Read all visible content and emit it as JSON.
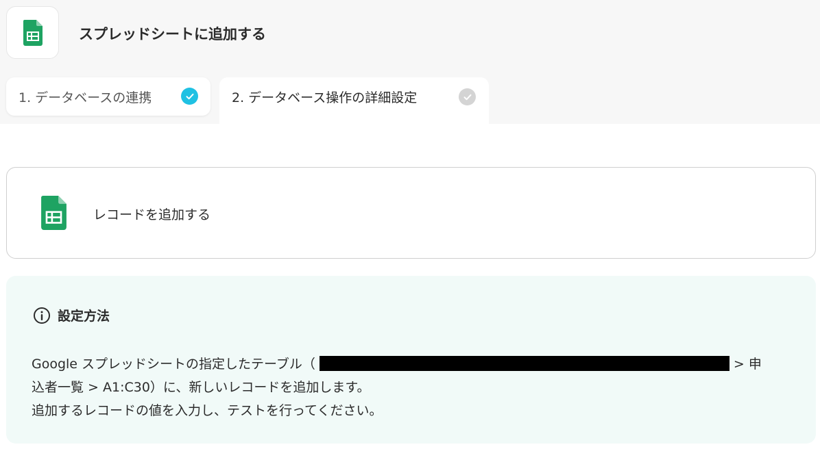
{
  "header": {
    "title": "スプレッドシートに追加する",
    "app_icon": "google-sheets-icon"
  },
  "tabs": [
    {
      "label": "1. データベースの連携",
      "status": "complete",
      "status_color": "#1fc1e3"
    },
    {
      "label": "2. データベース操作の詳細設定",
      "status": "pending",
      "status_color": "#d4d4d4"
    }
  ],
  "action": {
    "label": "レコードを追加する",
    "icon": "google-sheets-icon"
  },
  "info": {
    "title": "設定方法",
    "line1_pre": "Google スプレッドシートの指定したテーブル（",
    "line1_post": "> 申",
    "line2": "込者一覧 > A1:C30）に、新しいレコードを追加します。",
    "line3": "追加するレコードの値を入力し、テストを行ってください。"
  },
  "colors": {
    "sheets_green": "#1ea362",
    "info_bg": "#f1faf8"
  }
}
